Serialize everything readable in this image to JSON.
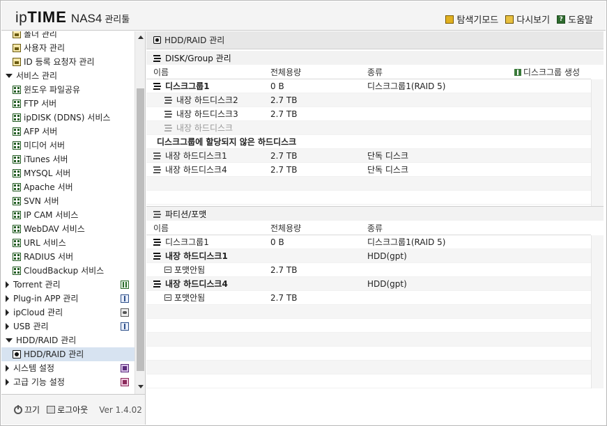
{
  "header": {
    "logo_ip": "ip",
    "logo_time": "TIME",
    "logo_nas": "NAS4",
    "logo_mgr": "관리툴",
    "links": [
      {
        "label": "탐색기모드",
        "icon": "folder-icon"
      },
      {
        "label": "다시보기",
        "icon": "refresh-icon"
      },
      {
        "label": "도움말",
        "icon": "help-icon"
      }
    ]
  },
  "sidebar": {
    "items": [
      {
        "label": "폴더 관리",
        "type": "sub",
        "icon": "folder"
      },
      {
        "label": "사용자 관리",
        "type": "sub",
        "icon": "folder"
      },
      {
        "label": "ID 등록 요청자 관리",
        "type": "sub",
        "icon": "folder"
      },
      {
        "label": "서비스 관리",
        "type": "top-open"
      },
      {
        "label": "윈도우 파일공유",
        "type": "sub",
        "icon": "grid"
      },
      {
        "label": "FTP 서버",
        "type": "sub",
        "icon": "grid"
      },
      {
        "label": "ipDISK (DDNS) 서비스",
        "type": "sub",
        "icon": "grid"
      },
      {
        "label": "AFP 서버",
        "type": "sub",
        "icon": "grid"
      },
      {
        "label": "미디어 서버",
        "type": "sub",
        "icon": "grid"
      },
      {
        "label": "iTunes 서버",
        "type": "sub",
        "icon": "grid"
      },
      {
        "label": "MYSQL 서버",
        "type": "sub",
        "icon": "grid"
      },
      {
        "label": "Apache 서버",
        "type": "sub",
        "icon": "grid"
      },
      {
        "label": "SVN 서버",
        "type": "sub",
        "icon": "grid"
      },
      {
        "label": "IP CAM 서비스",
        "type": "sub",
        "icon": "grid"
      },
      {
        "label": "WebDAV 서비스",
        "type": "sub",
        "icon": "grid"
      },
      {
        "label": "URL 서비스",
        "type": "sub",
        "icon": "grid"
      },
      {
        "label": "RADIUS 서버",
        "type": "sub",
        "icon": "grid"
      },
      {
        "label": "CloudBackup 서비스",
        "type": "sub",
        "icon": "grid"
      },
      {
        "label": "Torrent 관리",
        "type": "top-closed",
        "right_icon": "torrent"
      },
      {
        "label": "Plug-in APP 관리",
        "type": "top-closed",
        "right_icon": "plugin"
      },
      {
        "label": "ipCloud 관리",
        "type": "top-closed",
        "right_icon": "cloud"
      },
      {
        "label": "USB 관리",
        "type": "top-closed",
        "right_icon": "usb"
      },
      {
        "label": "HDD/RAID 관리",
        "type": "top-open"
      },
      {
        "label": "HDD/RAID 관리",
        "type": "sub",
        "icon": "disk",
        "selected": true
      },
      {
        "label": "시스템 설정",
        "type": "top-closed",
        "right_icon": "sys"
      },
      {
        "label": "고급 기능 설정",
        "type": "top-closed",
        "right_icon": "adv"
      }
    ],
    "footer": {
      "power_label": "끄기",
      "logout_label": "로그아웃",
      "version": "Ver 1.4.02"
    }
  },
  "main": {
    "panel_title": "HDD/RAID 관리",
    "disk_group": {
      "section_title": "DISK/Group 관리",
      "headers": [
        "이름",
        "전체용량",
        "종류"
      ],
      "create_label": "디스크그룹 생성",
      "rows": [
        {
          "name": "디스크그룹1",
          "size": "0 B",
          "kind": "디스크그룹1(RAID 5)",
          "style": "group"
        },
        {
          "name": "내장 하드디스크2",
          "size": "2.7 TB",
          "kind": "",
          "style": "member"
        },
        {
          "name": "내장 하드디스크3",
          "size": "2.7 TB",
          "kind": "",
          "style": "member"
        },
        {
          "name": "내장 하드디스크",
          "size": "",
          "kind": "",
          "style": "member-muted"
        },
        {
          "name": "디스크그룹에 할당되지 않은 하드디스크",
          "size": "",
          "kind": "",
          "style": "group"
        },
        {
          "name": "내장 하드디스크1",
          "size": "2.7 TB",
          "kind": "단독 디스크",
          "style": "disk"
        },
        {
          "name": "내장 하드디스크4",
          "size": "2.7 TB",
          "kind": "단독 디스크",
          "style": "disk"
        }
      ]
    },
    "partition": {
      "section_title": "파티션/포맷",
      "headers": [
        "이름",
        "전체용량",
        "종류"
      ],
      "rows": [
        {
          "name": "디스크그룹1",
          "size": "0 B",
          "kind": "디스크그룹1(RAID 5)",
          "style": "normal"
        },
        {
          "name": "내장 하드디스크1",
          "size": "",
          "kind": "HDD(gpt)",
          "style": "bold"
        },
        {
          "name": "포맷안됨",
          "size": "2.7 TB",
          "kind": "",
          "style": "part"
        },
        {
          "name": "내장 하드디스크4",
          "size": "",
          "kind": "HDD(gpt)",
          "style": "bold"
        },
        {
          "name": "포맷안됨",
          "size": "2.7 TB",
          "kind": "",
          "style": "part"
        }
      ]
    }
  }
}
